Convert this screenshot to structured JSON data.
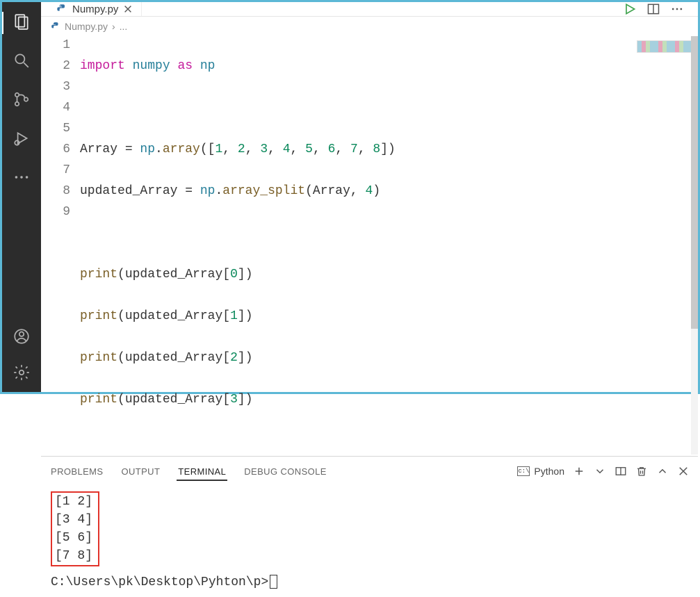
{
  "tab": {
    "filename": "Numpy.py"
  },
  "breadcrumb": {
    "filename": "Numpy.py",
    "sep": "›",
    "rest": "..."
  },
  "editor": {
    "linenos": [
      "1",
      "2",
      "3",
      "4",
      "5",
      "6",
      "7",
      "8",
      "9"
    ],
    "l1_import": "import",
    "l1_numpy": "numpy",
    "l1_as": "as",
    "l1_np": "np",
    "l3_var": "Array",
    "l3_eq": " = ",
    "l3_np": "np",
    "l3_dot": ".",
    "l3_array": "array",
    "l3_open": "([",
    "l3_n1": "1",
    "l3_c": ", ",
    "l3_n2": "2",
    "l3_n3": "3",
    "l3_n4": "4",
    "l3_n5": "5",
    "l3_n6": "6",
    "l3_n7": "7",
    "l3_n8": "8",
    "l3_close": "])",
    "l4_var": "updated_Array",
    "l4_eq": " = ",
    "l4_np": "np",
    "l4_dot": ".",
    "l4_split": "array_split",
    "l4_open": "(",
    "l4_arg1": "Array",
    "l4_c": ", ",
    "l4_arg2": "4",
    "l4_close": ")",
    "print": "print",
    "print_open": "(",
    "print_arr": "updated_Array",
    "br_o": "[",
    "br_c": "]",
    "print_close": ")",
    "idx0": "0",
    "idx1": "1",
    "idx2": "2",
    "idx3": "3"
  },
  "panel": {
    "tabs": {
      "problems": "PROBLEMS",
      "output": "OUTPUT",
      "terminal": "TERMINAL",
      "debug": "DEBUG CONSOLE"
    },
    "termKind": "Python"
  },
  "terminal": {
    "out1": "[1 2]",
    "out2": "[3 4]",
    "out3": "[5 6]",
    "out4": "[7 8]",
    "prompt": "C:\\Users\\pk\\Desktop\\Pyhton\\p>"
  }
}
